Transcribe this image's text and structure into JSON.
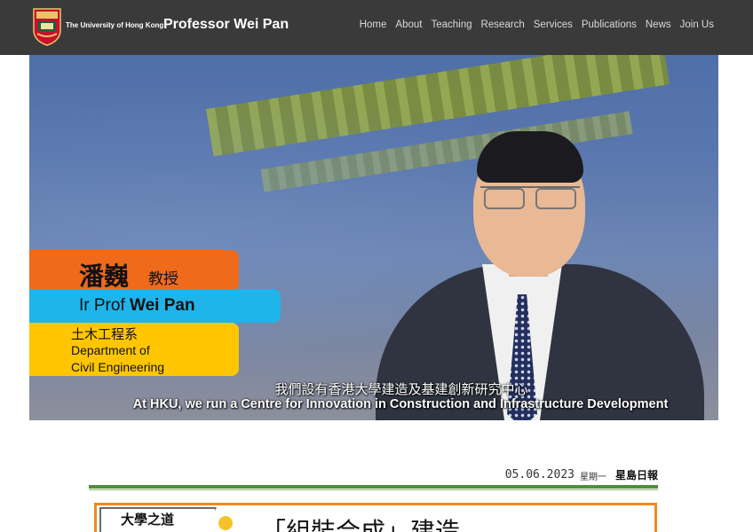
{
  "header": {
    "university_name": "The University of Hong Kong",
    "site_title": "Professor Wei Pan",
    "nav": [
      "Home",
      "About",
      "Teaching",
      "Research",
      "Services",
      "Publications",
      "News",
      "Join Us"
    ]
  },
  "hero": {
    "name_cn": "潘巍",
    "title_cn": "教授",
    "name_en_prefix": "Ir Prof ",
    "name_en": "Wei Pan",
    "dept_cn": "土木工程系",
    "dept_en_line1": "Department of",
    "dept_en_line2": "Civil Engineering",
    "subtitle_cn": "我們設有香港大學建造及基建創新研究中心",
    "subtitle_en": "At HKU, we run a Centre for Innovation in Construction and Infrastructure Development"
  },
  "news_clipping": {
    "date": "05.06.2023",
    "weekday": "星期一",
    "paper": "星島日報",
    "section": "大學之道",
    "headline": "「組裝合成」建造"
  },
  "colors": {
    "header_bg": "#3a3a3a",
    "orange": "#f06a1c",
    "blue": "#1fb4ea",
    "yellow": "#ffc600",
    "green_rule": "#4f8f3c"
  }
}
